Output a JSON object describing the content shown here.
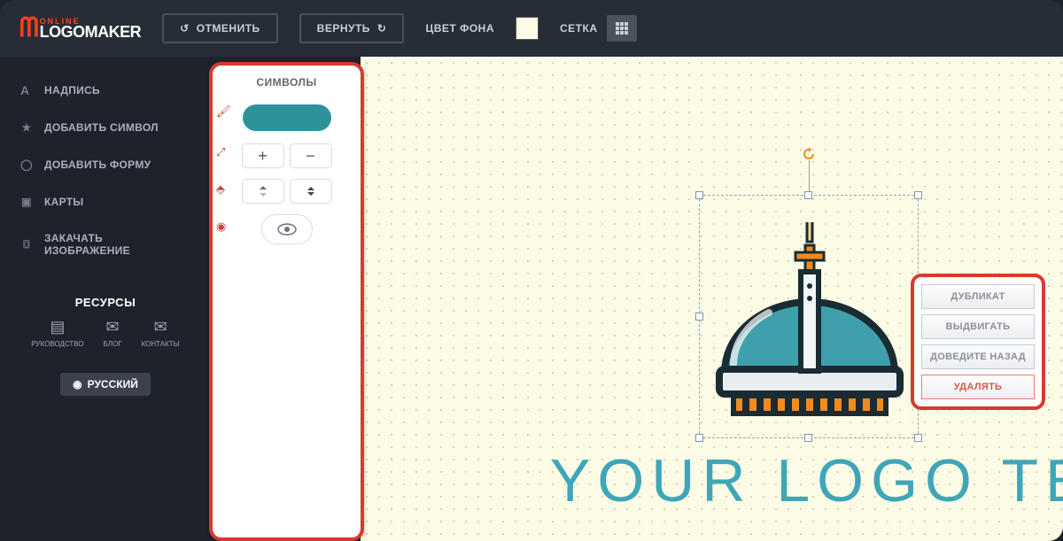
{
  "brand": {
    "line1": "ONLINE",
    "line2": "LOGOMAKER"
  },
  "toolbar": {
    "undo": "ОТМЕНИТЬ",
    "redo": "ВЕРНУТЬ",
    "bg_label": "ЦВЕТ ФОНА",
    "bg_color": "#fcfce6",
    "grid_label": "СЕТКА"
  },
  "sidebar": {
    "items": [
      {
        "icon": "text-icon",
        "label": "НАДПИСЬ"
      },
      {
        "icon": "star-icon",
        "label": "ДОБАВИТЬ СИМВОЛ"
      },
      {
        "icon": "circle-icon",
        "label": "ДОБАВИТЬ ФОРМУ"
      },
      {
        "icon": "cards-icon",
        "label": "КАРТЫ"
      },
      {
        "icon": "image-icon",
        "label": "ЗАКАЧАТЬ ИЗОБРАЖЕНИЕ"
      }
    ],
    "resources_title": "РЕСУРСЫ",
    "resources": [
      {
        "icon": "book-icon",
        "label": "РУКОВОДСТВО"
      },
      {
        "icon": "chat-icon",
        "label": "БЛОГ"
      },
      {
        "icon": "mail-icon",
        "label": "КОНТАКТЫ"
      }
    ],
    "language": "РУССКИЙ"
  },
  "panel": {
    "title": "СИМВОЛЫ",
    "fill_color": "#2e929a",
    "increase": "+",
    "decrease": "−"
  },
  "canvas": {
    "logo_text": "YOUR LOGO TEXT",
    "logo_text_color": "#3fa6b8"
  },
  "context_menu": {
    "duplicate": "ДУБЛИКАТ",
    "bring_forward": "ВЫДВИГАТЬ",
    "send_back": "ДОВЕДИТЕ НАЗАД",
    "delete": "УДАЛЯТЬ"
  }
}
